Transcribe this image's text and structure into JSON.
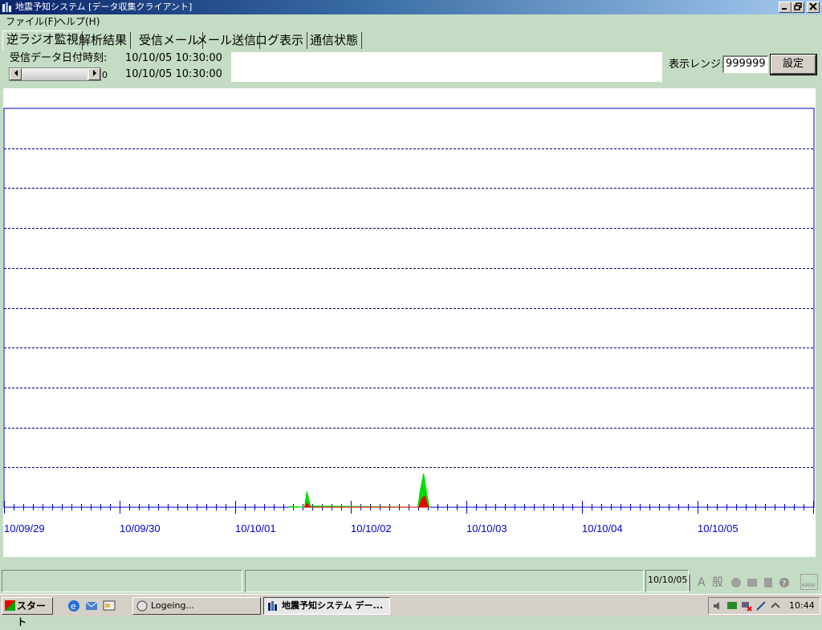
{
  "window": {
    "title": "地震予知システム [データ収集クライアント]",
    "controls": {
      "minimize": "_",
      "maximize": "🗗",
      "close": "×"
    }
  },
  "menu": [
    {
      "label": "ファイル(F)"
    },
    {
      "label": "ヘルプ(H)"
    }
  ],
  "tabs": [
    {
      "label": "逆ラジオ監視",
      "active": true
    },
    {
      "label": "解析結果"
    },
    {
      "label": "受信メール"
    },
    {
      "label": "メール送信"
    },
    {
      "label": "ログ表示"
    },
    {
      "label": "通信状態"
    }
  ],
  "info": {
    "received_label": "受信データ日付時刻:",
    "received_time_1": "10/10/05 10:30:00",
    "received_time_2": "10/10/05 10:30:00",
    "scroll_value": "0",
    "range_label": "表示レンジ:",
    "range_value": "999999",
    "set_button": "設定"
  },
  "chart_data": {
    "type": "area",
    "title": "",
    "xlabel": "",
    "ylabel": "",
    "x_tick_labels": [
      "10/09/29",
      "10/09/30",
      "10/10/01",
      "10/10/02",
      "10/10/03",
      "10/10/04",
      "10/10/05"
    ],
    "gridlines_horizontal": 9,
    "grid": true,
    "x_range_days": [
      0,
      7
    ],
    "series": [
      {
        "color": "#00dd00",
        "points": [
          [
            2.47,
            0.002
          ],
          [
            2.6,
            0.0
          ],
          [
            2.62,
            0.04
          ],
          [
            2.65,
            0.003
          ],
          [
            3.58,
            0.0
          ],
          [
            3.6,
            0.04
          ],
          [
            3.63,
            0.085
          ],
          [
            3.66,
            0.03
          ],
          [
            3.68,
            0.0
          ]
        ]
      },
      {
        "color": "#ee0000",
        "points": [
          [
            2.6,
            0.0
          ],
          [
            2.62,
            0.01
          ],
          [
            2.65,
            0.0
          ],
          [
            3.59,
            0.0
          ],
          [
            3.61,
            0.02
          ],
          [
            3.64,
            0.028
          ],
          [
            3.67,
            0.0
          ]
        ]
      }
    ],
    "colors": {
      "axis": "#0000cc",
      "grid": "#000080",
      "tick_label": "#0000cc"
    }
  },
  "status": {
    "pane1": "",
    "pane2": "",
    "pane3": "10/10/05"
  },
  "ime": {
    "items": [
      "A",
      "般"
    ],
    "kana": "KANA"
  },
  "taskbar": {
    "start": "スタート",
    "tasks": [
      {
        "label": "Logeing...",
        "active": false
      },
      {
        "label": "地震予知システム デー...",
        "active": true
      }
    ],
    "clock": "10:44"
  }
}
